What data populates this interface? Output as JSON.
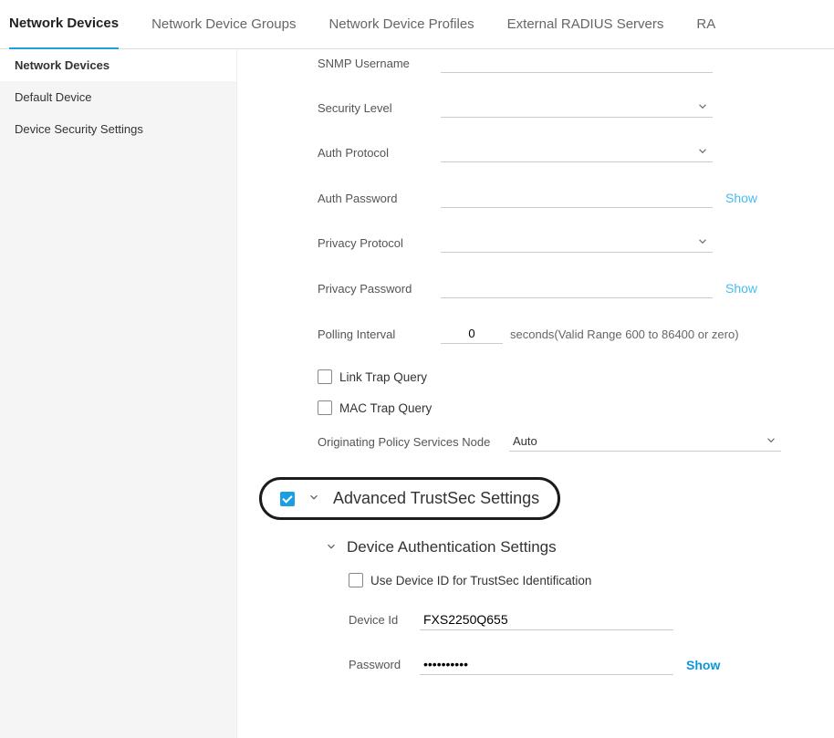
{
  "tabs": {
    "items": [
      {
        "label": "Network Devices",
        "active": true
      },
      {
        "label": "Network Device Groups",
        "active": false
      },
      {
        "label": "Network Device Profiles",
        "active": false
      },
      {
        "label": "External RADIUS Servers",
        "active": false
      },
      {
        "label": "RA",
        "active": false
      }
    ]
  },
  "sidebar": {
    "items": [
      {
        "label": "Network Devices",
        "active": true
      },
      {
        "label": "Default Device",
        "active": false
      },
      {
        "label": "Device Security Settings",
        "active": false
      }
    ]
  },
  "snmp": {
    "username_label": "SNMP Username",
    "username_value": "",
    "security_level_label": "Security Level",
    "security_level_value": "",
    "auth_protocol_label": "Auth Protocol",
    "auth_protocol_value": "",
    "auth_password_label": "Auth Password",
    "auth_password_value": "",
    "auth_password_show": "Show",
    "privacy_protocol_label": "Privacy Protocol",
    "privacy_protocol_value": "",
    "privacy_password_label": "Privacy Password",
    "privacy_password_value": "",
    "privacy_password_show": "Show",
    "polling_interval_label": "Polling Interval",
    "polling_interval_value": "0",
    "polling_hint": "seconds(Valid Range 600 to 86400 or zero)",
    "link_trap_label": "Link Trap Query",
    "mac_trap_label": "MAC Trap Query",
    "originating_label": "Originating Policy Services Node",
    "originating_value": "Auto"
  },
  "trustsec": {
    "section_title": "Advanced TrustSec Settings",
    "sub_title": "Device Authentication Settings",
    "use_device_id_label": "Use Device ID for TrustSec Identification",
    "device_id_label": "Device Id",
    "device_id_value": "FXS2250Q655",
    "password_label": "Password",
    "password_value": "••••••••••",
    "password_show": "Show"
  }
}
